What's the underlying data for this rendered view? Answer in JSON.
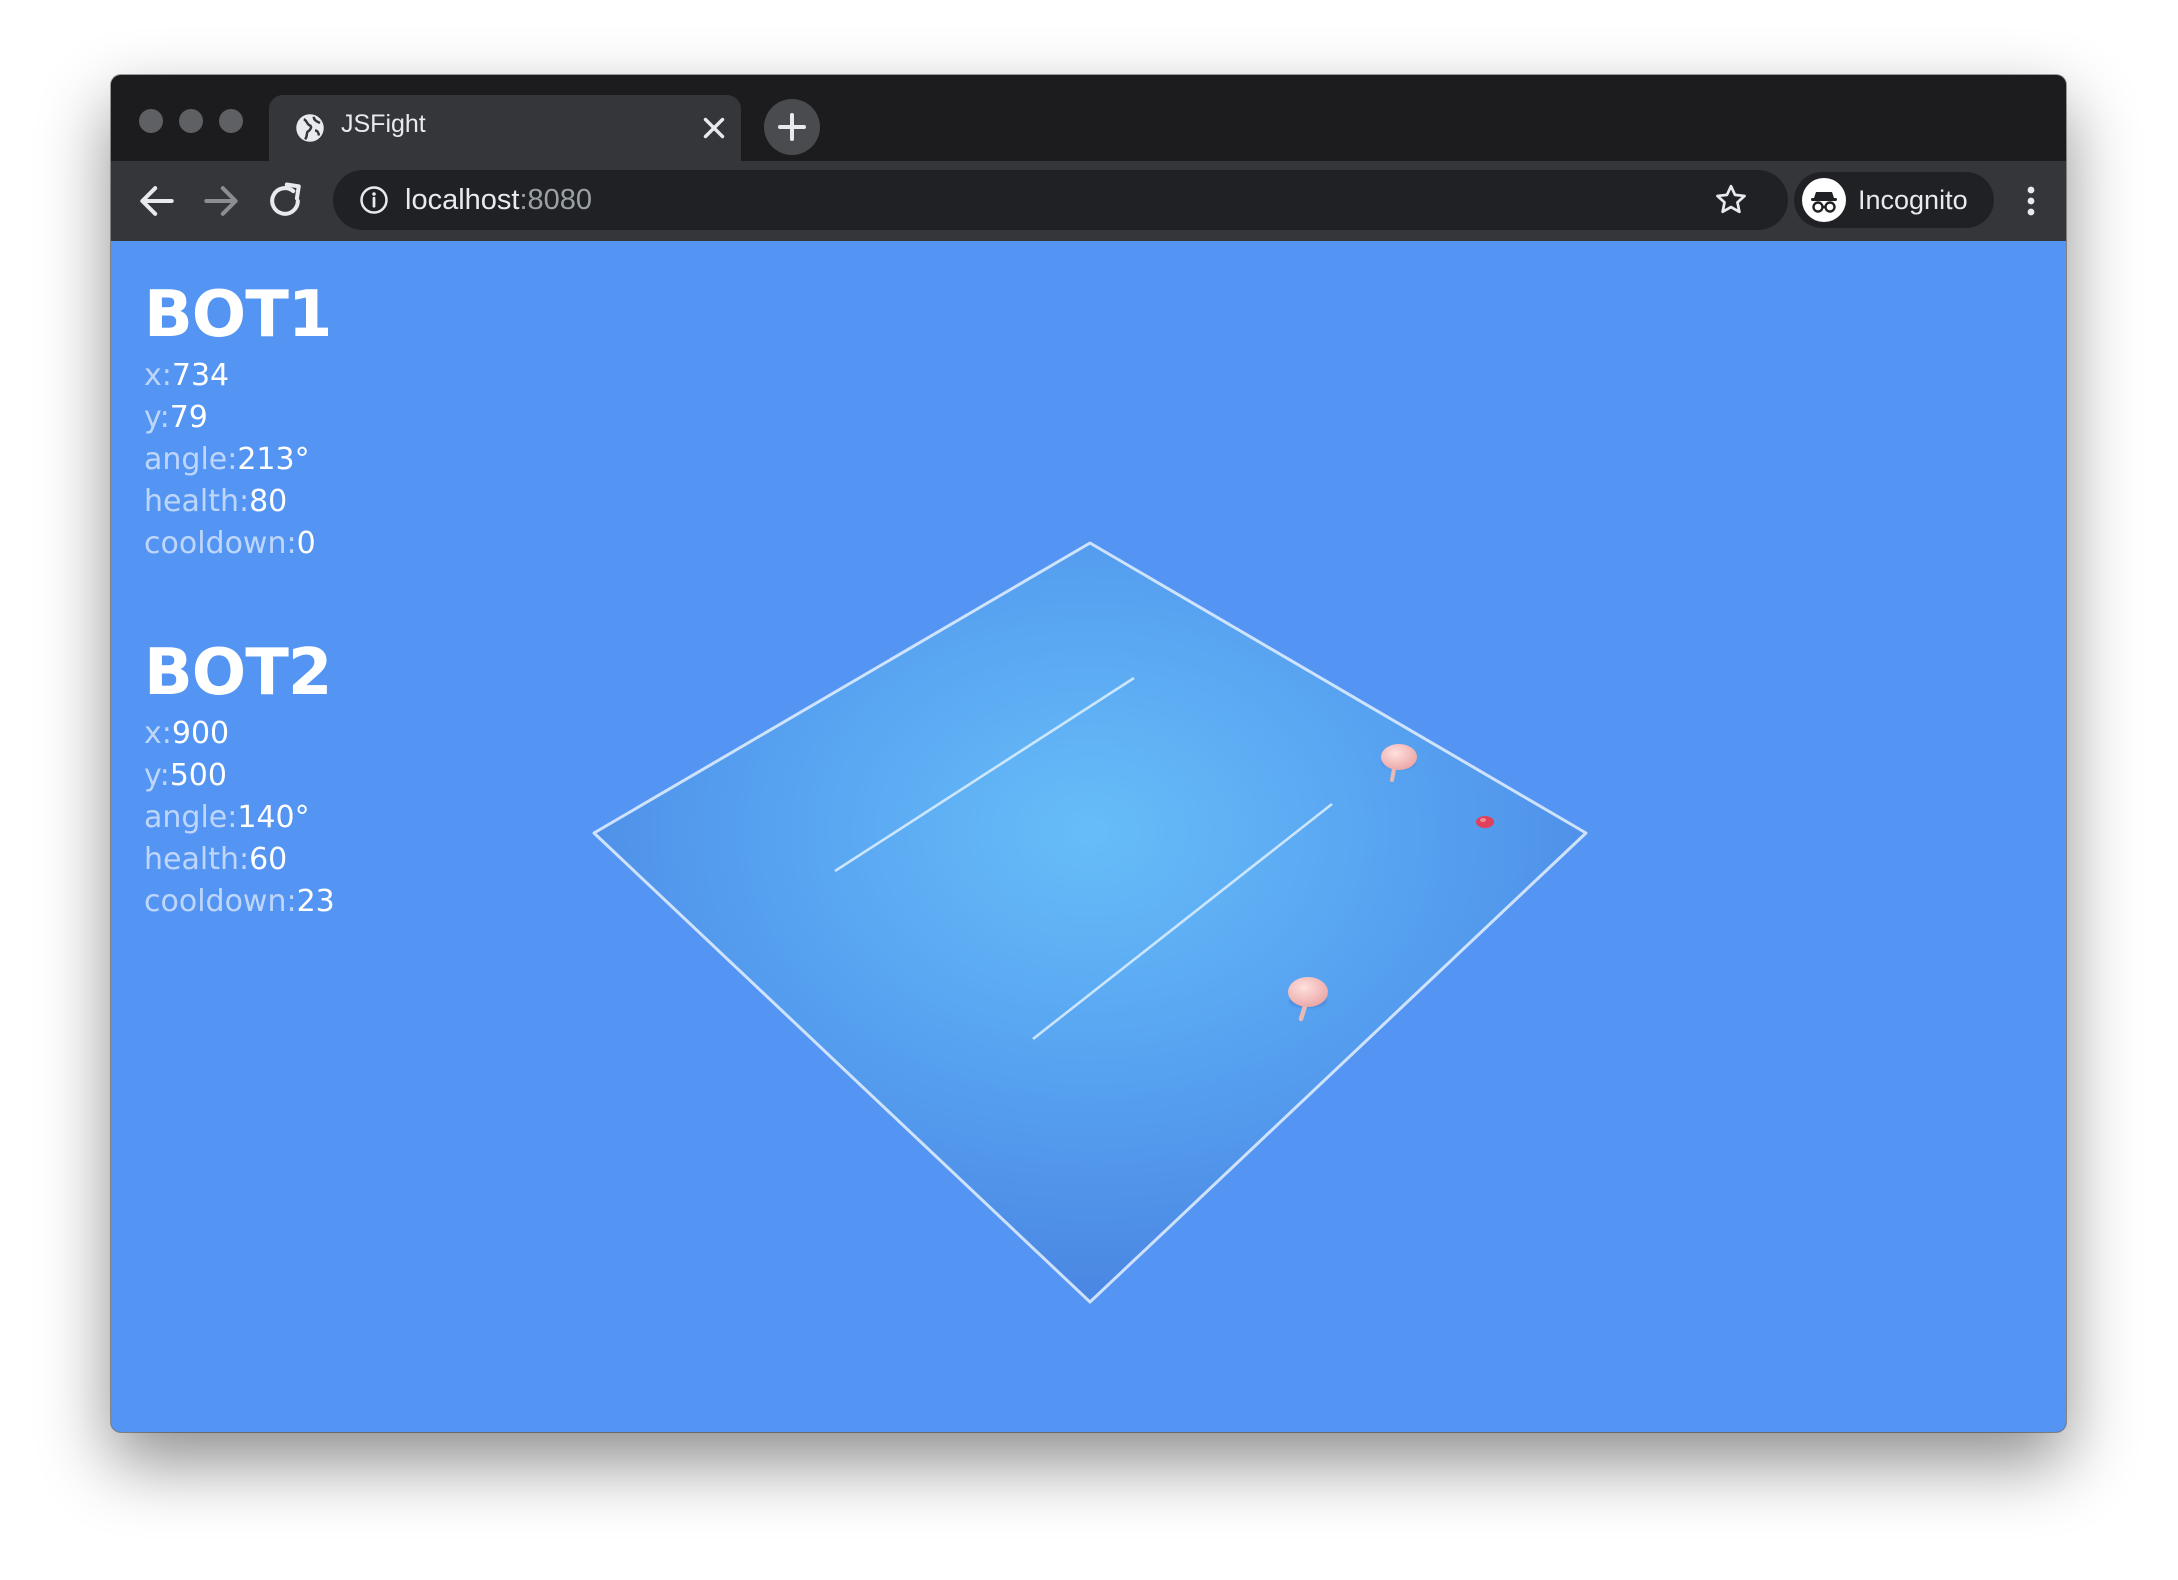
{
  "browser": {
    "tab_title": "JSFight",
    "url_host": "localhost",
    "url_port": ":8080",
    "profile_label": "Incognito"
  },
  "icons": [
    "globe-icon",
    "close-icon",
    "plus-icon",
    "back-arrow-icon",
    "forward-arrow-icon",
    "reload-icon",
    "info-icon",
    "star-icon",
    "incognito-icon",
    "more-vert-icon"
  ],
  "colors": {
    "viewport_bg": "#5494f2",
    "arena_center": "#66bdf8",
    "arena_edge": "#4b88e6",
    "bot_color": "#f1b3b3",
    "bullet_color": "#e0405c"
  },
  "bots": [
    {
      "title": "BOT1",
      "stats": [
        {
          "key": "x:",
          "value": "734"
        },
        {
          "key": "y:",
          "value": "79"
        },
        {
          "key": "angle:",
          "value": "213°"
        },
        {
          "key": "health:",
          "value": "80"
        },
        {
          "key": "cooldown:",
          "value": "0"
        }
      ]
    },
    {
      "title": "BOT2",
      "stats": [
        {
          "key": "x:",
          "value": "900"
        },
        {
          "key": "y:",
          "value": "500"
        },
        {
          "key": "angle:",
          "value": "140°"
        },
        {
          "key": "health:",
          "value": "60"
        },
        {
          "key": "cooldown:",
          "value": "23"
        }
      ]
    }
  ]
}
